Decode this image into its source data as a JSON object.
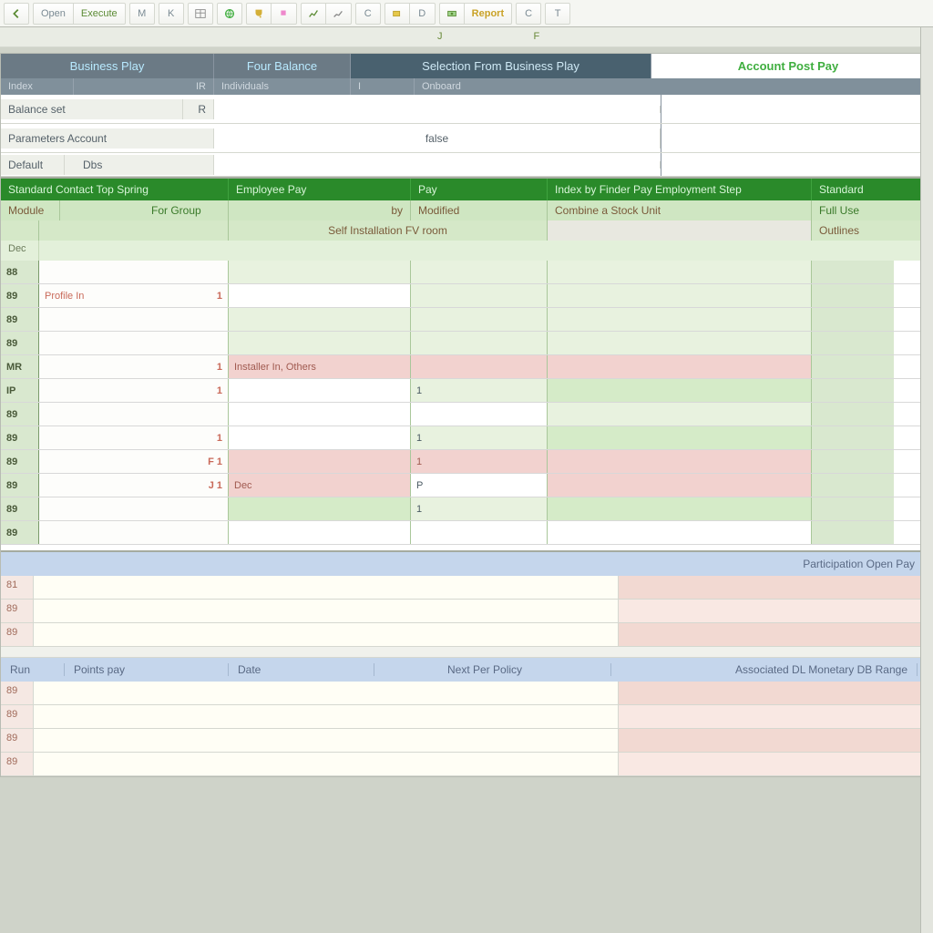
{
  "toolbar": {
    "items": [
      {
        "label": "",
        "icon": "arrow-left-icon",
        "kind": "icon"
      },
      {
        "label": "Open",
        "kind": "text"
      },
      {
        "label": "Execute",
        "kind": "text-green"
      },
      {
        "label": "M",
        "kind": "letter"
      },
      {
        "label": "K",
        "kind": "letter"
      },
      {
        "label": "",
        "icon": "table-icon",
        "kind": "icon"
      },
      {
        "label": "",
        "icon": "globe-icon",
        "kind": "icon-green"
      },
      {
        "label": "",
        "icon": "trophy-icon",
        "kind": "icon-green"
      },
      {
        "label": "",
        "icon": "chart-icon",
        "kind": "icon"
      },
      {
        "label": "",
        "icon": "chart2-icon",
        "kind": "icon"
      },
      {
        "label": "C",
        "kind": "letter"
      },
      {
        "label": "",
        "icon": "battery-icon",
        "kind": "icon"
      },
      {
        "label": "D",
        "kind": "letter"
      },
      {
        "label": "",
        "icon": "money-icon",
        "kind": "icon-green"
      },
      {
        "label": "Report",
        "kind": "text-yellow"
      },
      {
        "label": "C",
        "kind": "letter"
      },
      {
        "label": "T",
        "kind": "letter"
      }
    ]
  },
  "col_markers": {
    "a": "J",
    "b": "F"
  },
  "grid_a": {
    "headers": [
      "Business Play",
      "Four Balance",
      "Selection From Business Play",
      "Account Post Pay"
    ],
    "subheaders": [
      "Index",
      "IR",
      "Individuals",
      "I",
      "Onboard"
    ],
    "rows": [
      [
        "Balance set",
        "R"
      ],
      [
        "Parameters Account",
        "",
        "",
        "false",
        "",
        "",
        ""
      ],
      [
        "Default",
        "Dbs"
      ]
    ],
    "center_label": "false"
  },
  "grid_b": {
    "headers": [
      "Standard Contact Top Spring",
      "Employee Pay",
      "Pay",
      "Index by Finder Pay Employment Step",
      "Standard"
    ],
    "sub1": [
      "Module",
      "For Group",
      "by",
      "Modified",
      "Combine a Stock Unit",
      "Full Use"
    ],
    "sub1_right": "Outlines",
    "sub2": [
      "Dec",
      "",
      "",
      "Self Installation FV room",
      "",
      ""
    ],
    "rows": [
      {
        "hdr": "88",
        "gap": "",
        "c": "",
        "c_cls": "lg",
        "d": "",
        "d_cls": "lg",
        "e": "",
        "e_cls": "lg",
        "f": ""
      },
      {
        "hdr": "89",
        "gap": "Profile In",
        "gap_val": "1",
        "c": "",
        "c_cls": "",
        "d": "",
        "d_cls": "lg",
        "e": "",
        "e_cls": "lg",
        "f": ""
      },
      {
        "hdr": "89",
        "gap": "",
        "gap_val": "",
        "c": "",
        "c_cls": "lg",
        "d": "",
        "d_cls": "lg",
        "e": "",
        "e_cls": "lg",
        "f": ""
      },
      {
        "hdr": "89",
        "gap": "",
        "gap_val": "",
        "c": "",
        "c_cls": "lg",
        "d": "",
        "d_cls": "lg",
        "e": "",
        "e_cls": "lg",
        "f": ""
      },
      {
        "hdr": "MR",
        "gap": "",
        "gap_val": "1",
        "c": "Installer In, Others",
        "c_cls": "r",
        "d": "",
        "d_cls": "r",
        "e": "",
        "e_cls": "r",
        "f": ""
      },
      {
        "hdr": "IP",
        "gap": "",
        "gap_val": "1",
        "c": "",
        "c_cls": "",
        "d": "1",
        "d_cls": "lg",
        "e": "",
        "e_cls": "g",
        "f": ""
      },
      {
        "hdr": "89",
        "gap": "",
        "gap_val": "",
        "c": "",
        "c_cls": "",
        "d": "",
        "d_cls": "",
        "e": "",
        "e_cls": "lg",
        "f": ""
      },
      {
        "hdr": "89",
        "gap": "",
        "gap_val": "1",
        "c": "",
        "c_cls": "",
        "d": "1",
        "d_cls": "lg",
        "e": "",
        "e_cls": "g",
        "f": ""
      },
      {
        "hdr": "89",
        "gap": "",
        "gap_val": "F 1",
        "c": "",
        "c_cls": "r",
        "d": "1",
        "d_cls": "r",
        "e": "",
        "e_cls": "r",
        "f": ""
      },
      {
        "hdr": "89",
        "gap": "",
        "gap_val": "J 1",
        "c": "Dec",
        "c_cls": "r",
        "d": "P",
        "d_cls": "",
        "e": "",
        "e_cls": "r",
        "f": ""
      },
      {
        "hdr": "89",
        "gap": "",
        "gap_val": "",
        "c": "",
        "c_cls": "g",
        "d": "1",
        "d_cls": "lg",
        "e": "",
        "e_cls": "g",
        "f": ""
      },
      {
        "hdr": "89",
        "gap": "",
        "gap_val": "",
        "c": "",
        "c_cls": "",
        "d": "",
        "d_cls": "",
        "e": "",
        "e_cls": "",
        "f": ""
      }
    ]
  },
  "grid_c": {
    "section1_header": "Participation Open Pay",
    "section1_rows": [
      "81",
      "89",
      "89"
    ],
    "section2_headers": [
      "Run",
      "Points pay",
      "Date",
      "",
      "Next Per Policy",
      "Associated DL Monetary DB Range"
    ],
    "section2_rows": [
      "89",
      "89",
      "89",
      "89"
    ]
  }
}
